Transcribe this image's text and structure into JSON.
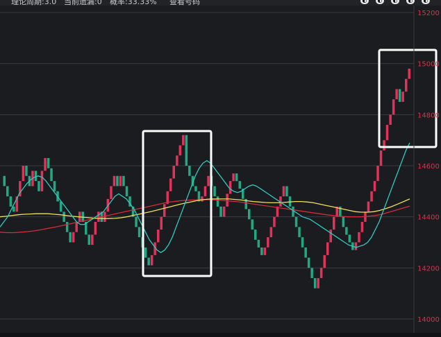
{
  "top_bar": {
    "theory_period": "理论周期:3.0",
    "current_gap": "当前遗漏:0",
    "probability": "概率:33.33%",
    "view_button": "查看号码",
    "icons": [
      "circle-icon-1",
      "circle-icon-2",
      "circle-icon-3",
      "circle-icon-4",
      "circle-icon-5"
    ]
  },
  "colors": {
    "background": "#1b1c20",
    "grid": "#3a3b40",
    "up": "#e0335a",
    "down": "#22a882",
    "ma_fast": "#2fc9c0",
    "ma_mid": "#f1e05a",
    "ma_slow": "#d52b3a",
    "highlight_box": "#ffffff",
    "axis_text": "#d6344b"
  },
  "chart_data": {
    "type": "line",
    "description_series": "kline-like trend bars with moving averages",
    "ylim": [
      14000,
      15200
    ],
    "y_ticks": [
      "15200",
      "15000",
      "14800",
      "14600",
      "14400",
      "14200",
      "14000"
    ],
    "y_tick_values": [
      15200,
      15000,
      14800,
      14600,
      14400,
      14200,
      14000
    ],
    "closes": [
      14560,
      14520,
      14480,
      14440,
      14420,
      14480,
      14540,
      14600,
      14560,
      14520,
      14580,
      14540,
      14500,
      14580,
      14630,
      14590,
      14540,
      14500,
      14460,
      14420,
      14380,
      14340,
      14300,
      14340,
      14380,
      14420,
      14380,
      14330,
      14290,
      14330,
      14380,
      14420,
      14380,
      14420,
      14470,
      14520,
      14560,
      14520,
      14560,
      14520,
      14480,
      14440,
      14400,
      14360,
      14320,
      14280,
      14240,
      14210,
      14250,
      14300,
      14350,
      14400,
      14450,
      14500,
      14550,
      14600,
      14640,
      14680,
      14720,
      14600,
      14560,
      14520,
      14500,
      14460,
      14480,
      14520,
      14560,
      14520,
      14480,
      14440,
      14400,
      14440,
      14490,
      14540,
      14570,
      14540,
      14510,
      14470,
      14430,
      14390,
      14350,
      14310,
      14280,
      14250,
      14280,
      14320,
      14360,
      14400,
      14440,
      14480,
      14520,
      14480,
      14440,
      14400,
      14360,
      14320,
      14280,
      14240,
      14200,
      14160,
      14120,
      14160,
      14200,
      14250,
      14300,
      14350,
      14400,
      14440,
      14400,
      14360,
      14330,
      14300,
      14270,
      14300,
      14340,
      14380,
      14420,
      14460,
      14500,
      14540,
      14600,
      14660,
      14700,
      14760,
      14800,
      14860,
      14900,
      14850,
      14890,
      14940,
      14980
    ],
    "ma_fast": [
      14360,
      14380,
      14400,
      14430,
      14460,
      14490,
      14510,
      14530,
      14545,
      14555,
      14560,
      14555,
      14540,
      14520,
      14500,
      14480,
      14460,
      14440,
      14420,
      14400,
      14380,
      14370,
      14370,
      14380,
      14390,
      14400,
      14410,
      14420,
      14440,
      14460,
      14480,
      14490,
      14480,
      14470,
      14450,
      14430,
      14400,
      14370,
      14340,
      14310,
      14290,
      14270,
      14260,
      14270,
      14290,
      14320,
      14360,
      14400,
      14440,
      14480,
      14520,
      14560,
      14590,
      14610,
      14620,
      14610,
      14590,
      14570,
      14550,
      14530,
      14510,
      14500,
      14495,
      14500,
      14510,
      14520,
      14525,
      14520,
      14510,
      14500,
      14490,
      14480,
      14470,
      14460,
      14450,
      14440,
      14430,
      14420,
      14410,
      14400,
      14395,
      14390,
      14380,
      14370,
      14360,
      14350,
      14340,
      14330,
      14320,
      14310,
      14300,
      14290,
      14285,
      14280,
      14285,
      14290,
      14300,
      14320,
      14350,
      14380,
      14420,
      14460,
      14500,
      14540,
      14580,
      14620,
      14660,
      14690
    ],
    "ma_mid": [
      14400,
      14402,
      14405,
      14408,
      14410,
      14411,
      14412,
      14412,
      14412,
      14410,
      14408,
      14405,
      14402,
      14400,
      14398,
      14396,
      14394,
      14393,
      14393,
      14394,
      14396,
      14400,
      14405,
      14410,
      14415,
      14420,
      14426,
      14432,
      14438,
      14444,
      14450,
      14455,
      14460,
      14465,
      14468,
      14470,
      14470,
      14470,
      14470,
      14468,
      14466,
      14463,
      14460,
      14458,
      14456,
      14455,
      14455,
      14456,
      14458,
      14460,
      14460,
      14458,
      14455,
      14450,
      14445,
      14440,
      14435,
      14430,
      14425,
      14420,
      14418,
      14418,
      14420,
      14425,
      14432,
      14440,
      14450,
      14460,
      14470
    ],
    "ma_slow": [
      14340,
      14338,
      14338,
      14340,
      14342,
      14345,
      14350,
      14355,
      14360,
      14366,
      14372,
      14378,
      14384,
      14390,
      14396,
      14402,
      14408,
      14414,
      14420,
      14426,
      14432,
      14438,
      14444,
      14450,
      14456,
      14460,
      14463,
      14465,
      14466,
      14467,
      14467,
      14466,
      14464,
      14462,
      14460,
      14456,
      14452,
      14448,
      14444,
      14440,
      14436,
      14432,
      14428,
      14424,
      14420,
      14416,
      14412,
      14408,
      14405,
      14402,
      14400,
      14400,
      14400,
      14402,
      14405,
      14410,
      14418,
      14426,
      14434,
      14442
    ]
  }
}
